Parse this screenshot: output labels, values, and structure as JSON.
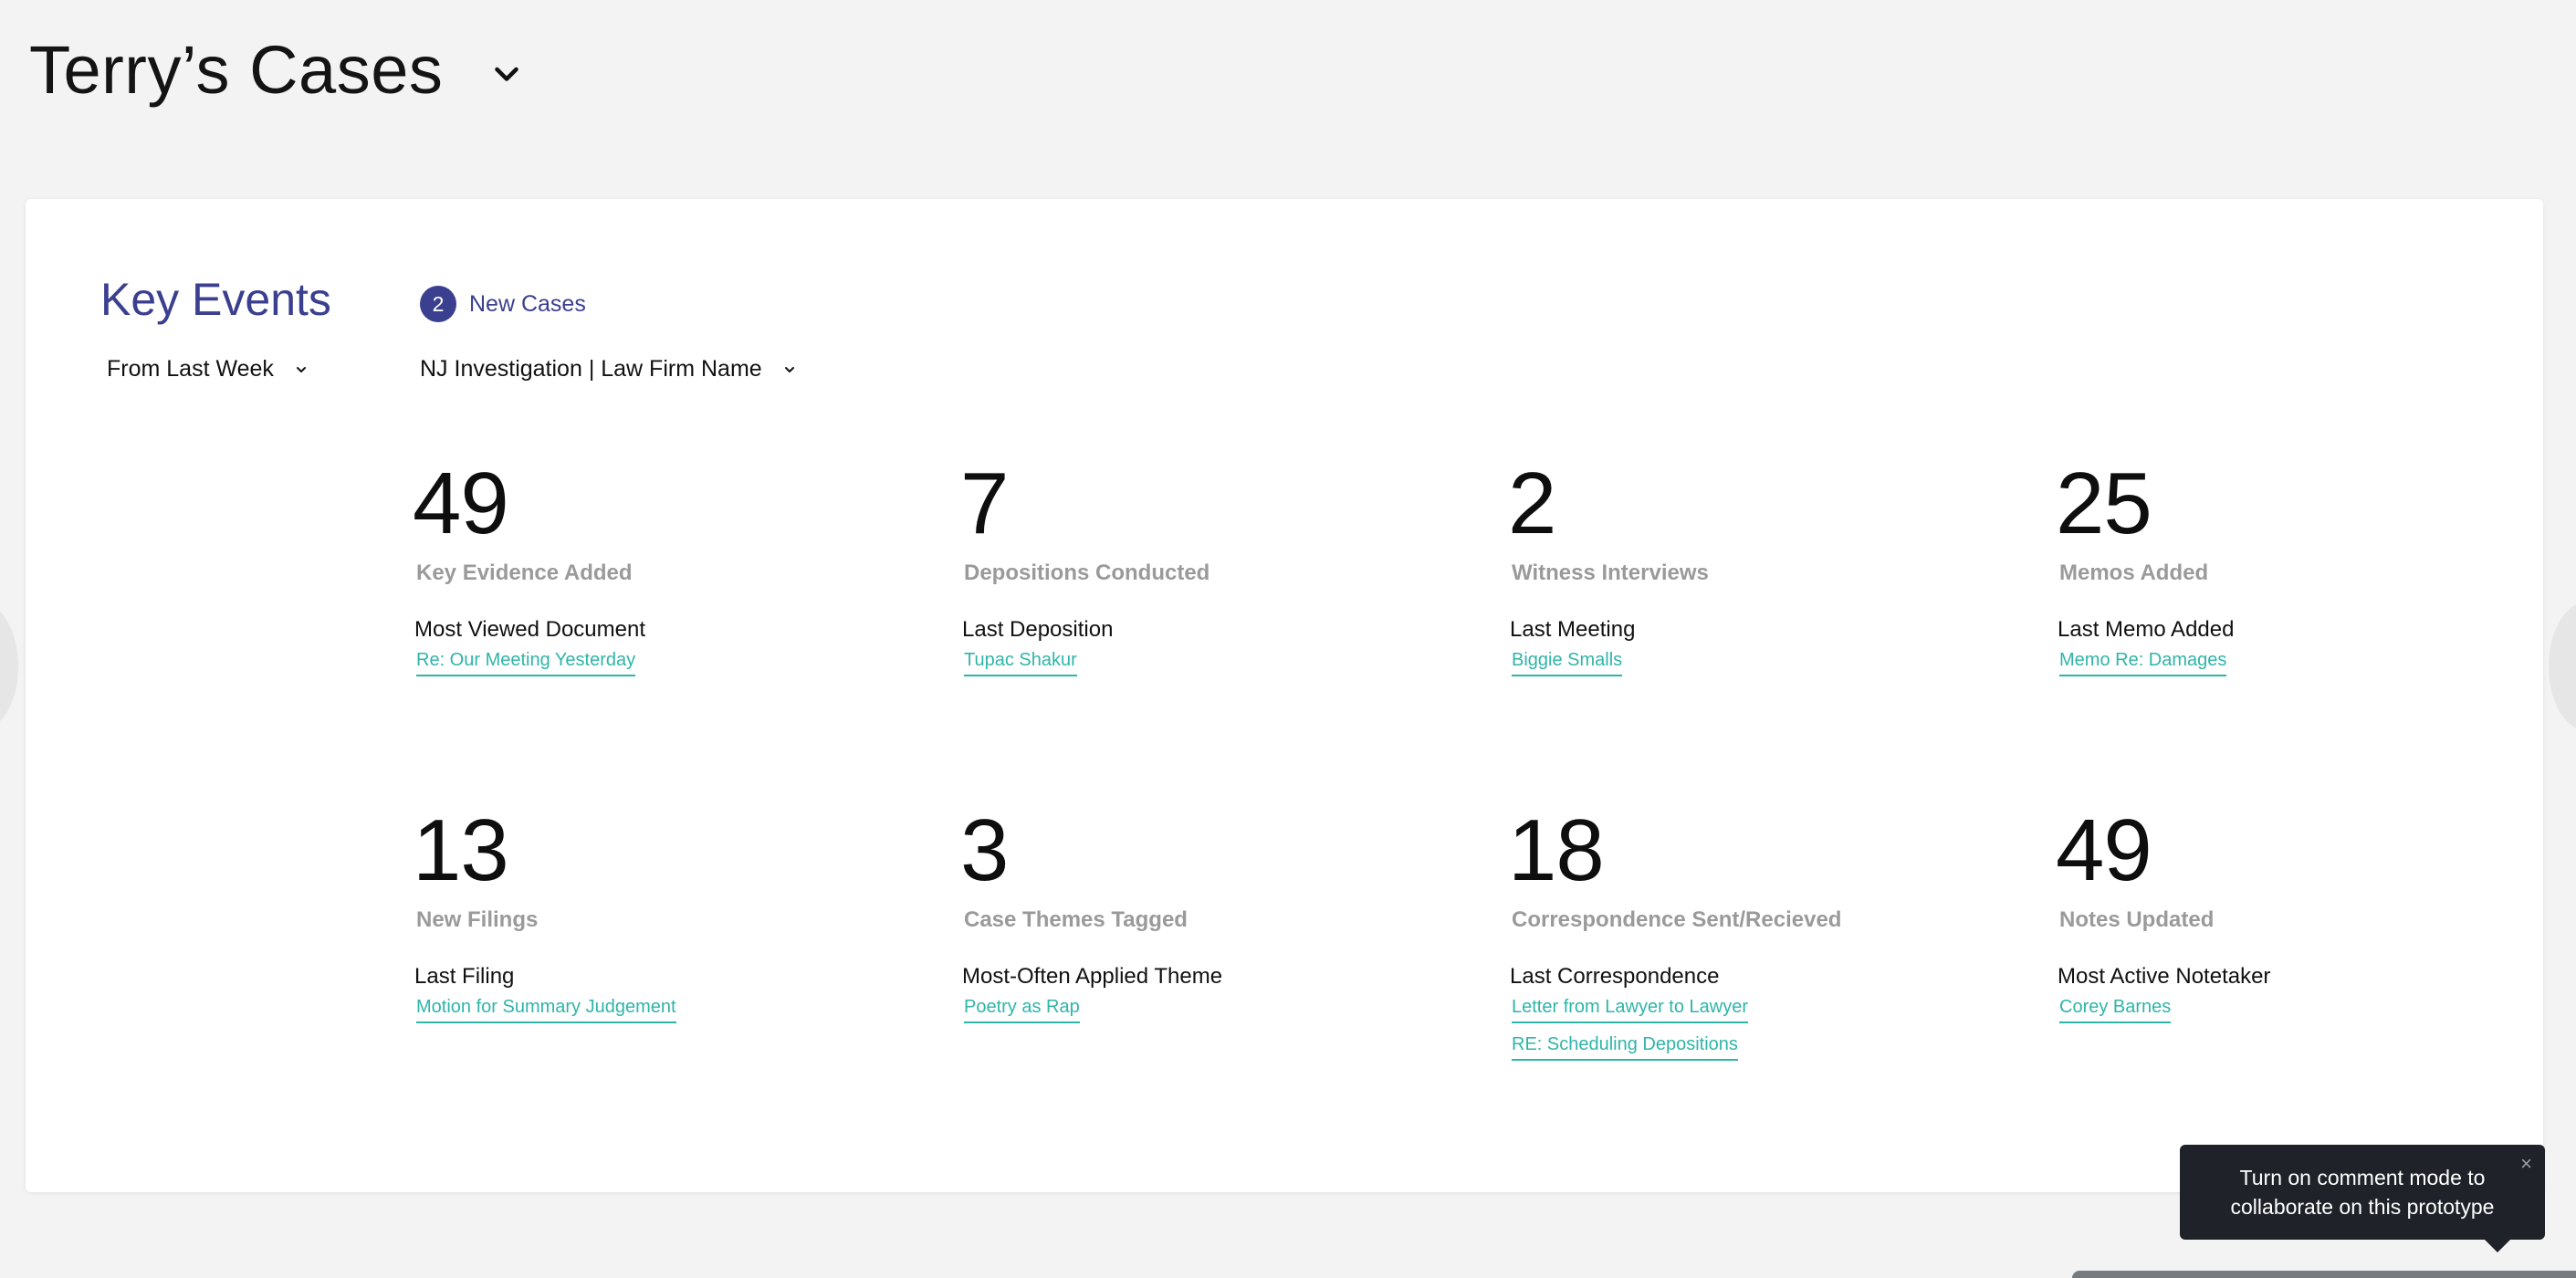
{
  "header": {
    "title": "Terry’s Cases"
  },
  "key_events": {
    "title": "Key Events",
    "new_cases_count": "2",
    "new_cases_label": "New Cases",
    "period_selected": "From Last Week",
    "case_selected": "NJ Investigation | Law Firm Name"
  },
  "stats": [
    {
      "value": "49",
      "label": "Key Evidence Added",
      "sub_title": "Most Viewed Document",
      "links": [
        "Re: Our Meeting Yesterday"
      ]
    },
    {
      "value": "7",
      "label": "Depositions Conducted",
      "sub_title": "Last Deposition",
      "links": [
        "Tupac Shakur"
      ]
    },
    {
      "value": "2",
      "label": "Witness Interviews",
      "sub_title": "Last Meeting",
      "links": [
        "Biggie Smalls"
      ]
    },
    {
      "value": "25",
      "label": "Memos Added",
      "sub_title": "Last Memo Added",
      "links": [
        "Memo Re: Damages"
      ]
    },
    {
      "value": "13",
      "label": "New Filings",
      "sub_title": "Last Filing",
      "links": [
        "Motion for Summary Judgement"
      ]
    },
    {
      "value": "3",
      "label": "Case Themes Tagged",
      "sub_title": "Most-Often Applied Theme",
      "links": [
        "Poetry as Rap"
      ]
    },
    {
      "value": "18",
      "label": "Correspondence Sent/Recieved",
      "sub_title": "Last Correspondence",
      "links": [
        "Letter from Lawyer to Lawyer",
        "RE: Scheduling Depositions"
      ]
    },
    {
      "value": "49",
      "label": "Notes Updated",
      "sub_title": "Most Active Notetaker",
      "links": [
        "Corey Barnes"
      ]
    }
  ],
  "tooltip": {
    "text": "Turn on comment mode to collaborate on this prototype",
    "close_glyph": "×"
  },
  "colors": {
    "accent": "#3b3f8f",
    "link": "#2fb5a8",
    "muted_label": "#9a9a9a",
    "tooltip_bg": "#1f2329"
  }
}
